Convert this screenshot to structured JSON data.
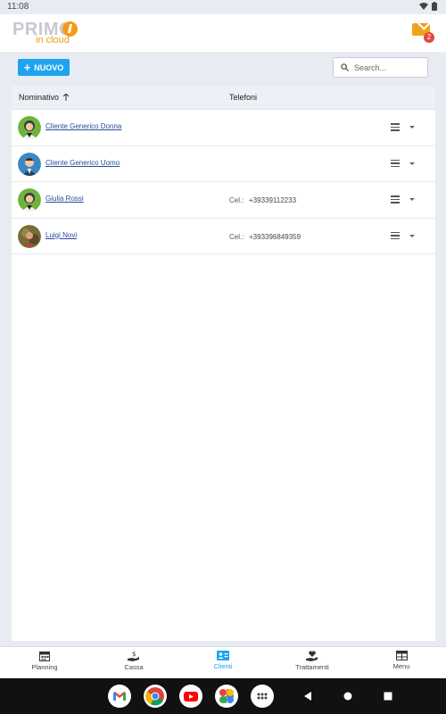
{
  "status": {
    "time": "11:08"
  },
  "app": {
    "logo_primary": "PRIMO",
    "logo_secondary": "in cloud",
    "mail_badge": "2"
  },
  "toolbar": {
    "new_label": "NUOVO",
    "search_placeholder": "Search..."
  },
  "table": {
    "columns": {
      "name": "Nominativo",
      "phones": "Telefoni"
    },
    "rows": [
      {
        "name": "Cliente Generico Donna",
        "phone_label": "",
        "phone": "",
        "avatar": "female-avatar-icon"
      },
      {
        "name": "Cliente Generico Uomo",
        "phone_label": "",
        "phone": "",
        "avatar": "male-avatar-icon"
      },
      {
        "name": "Giulia Rossi",
        "phone_label": "Cel.:",
        "phone": "+39339112233",
        "avatar": "female-avatar-icon"
      },
      {
        "name": "Luigi Novi",
        "phone_label": "Cel.:",
        "phone": "+393396849359",
        "avatar": "photo-avatar-icon"
      }
    ]
  },
  "nav": {
    "planning": "Planning",
    "cassa": "Cassa",
    "clienti": "Clienti",
    "trattamenti": "Trattamenti",
    "menu": "Menu",
    "active_color": "#1ea4ef"
  }
}
